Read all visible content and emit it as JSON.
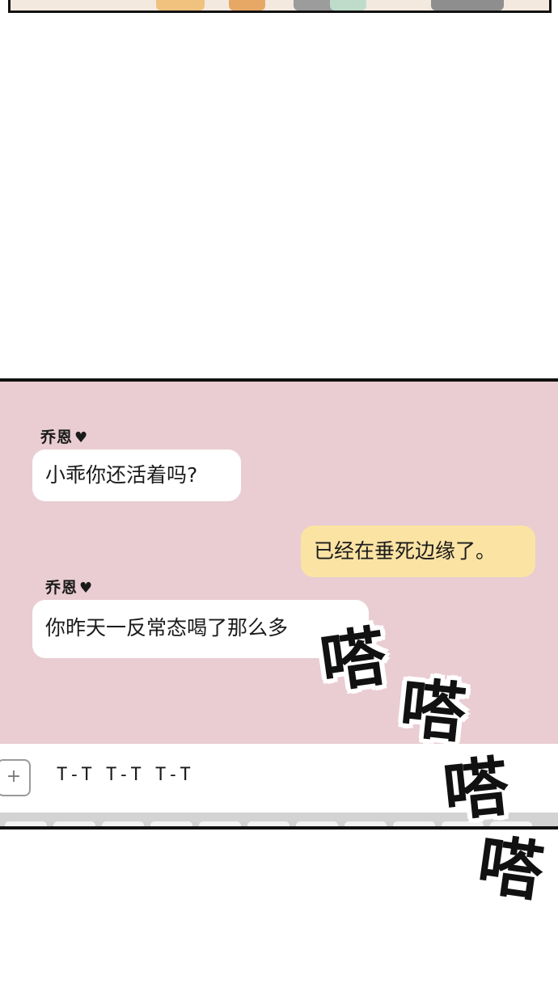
{
  "chat": {
    "messages": [
      {
        "sender": "乔恩",
        "sender_icon": "heart-icon",
        "text": "小乖你还活着吗?",
        "direction": "incoming"
      },
      {
        "text": "已经在垂死边缘了。",
        "direction": "outgoing"
      },
      {
        "sender": "乔恩",
        "sender_icon": "heart-icon",
        "text": "你昨天一反常态喝了那么多",
        "direction": "incoming"
      }
    ],
    "input_value": "T-T T-T T-T",
    "add_button_symbol": "+"
  },
  "sfx": [
    "嗒",
    "嗒",
    "嗒",
    "嗒"
  ],
  "colors": {
    "chat_background": "#e9cdd2",
    "incoming_bubble": "#ffffff",
    "outgoing_bubble": "#fbe3a4",
    "border": "#111111"
  }
}
